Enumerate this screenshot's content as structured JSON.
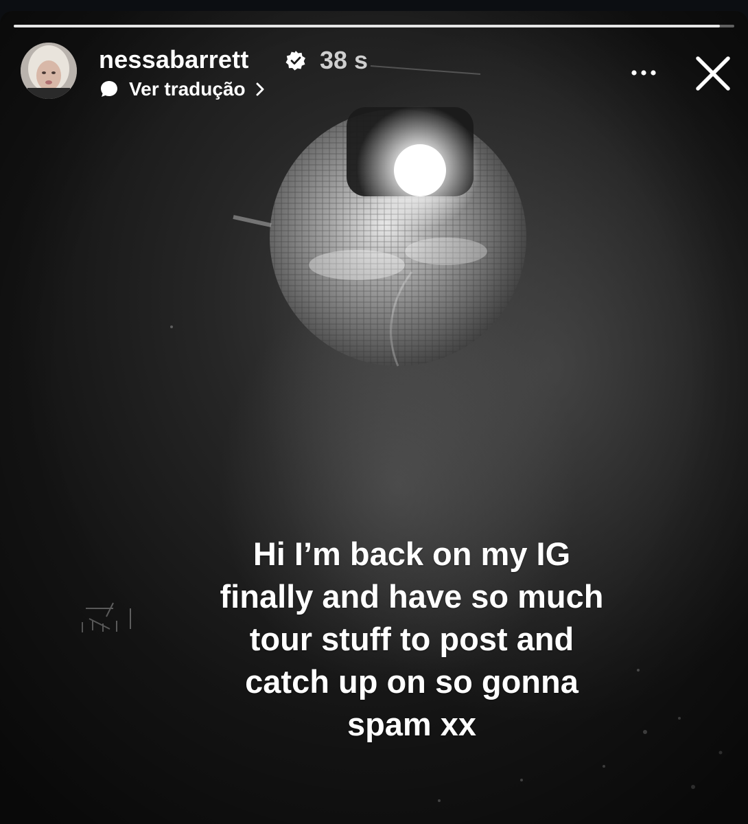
{
  "story": {
    "progress": 0.98,
    "colors": {
      "track": "#e6e6e6",
      "text": "#ffffff",
      "timestamp": "#cfcfcf"
    }
  },
  "header": {
    "username": "nessabarrett",
    "verified": true,
    "timestamp": "38 s",
    "translate_label": "Ver tradução",
    "icons": {
      "avatar": "avatar-photo",
      "verified": "verified-badge-icon",
      "translate": "speech-bubble-icon",
      "chevron": "chevron-right-icon",
      "more": "more-icon",
      "close": "close-icon"
    }
  },
  "caption": {
    "lines": [
      "Hi I’m back on my IG",
      "finally and have so much",
      "tour stuff to post and",
      "catch up on so gonna",
      "spam xx"
    ]
  }
}
